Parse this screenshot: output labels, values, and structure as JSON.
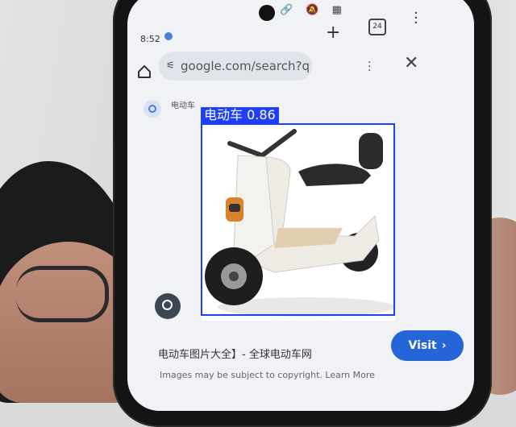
{
  "status_bar": {
    "time": "8:52"
  },
  "browser": {
    "tab_count": "24",
    "url": "google.com/search?q=目"
  },
  "search_chip": {
    "label": "电动车"
  },
  "detection": {
    "label": "电动车 0.86",
    "class": "电动车",
    "confidence": 0.86,
    "box_color": "#1f3fff"
  },
  "result": {
    "title": "电动车图片大全】- 全球电动车网",
    "visit_label": "Visit",
    "fine_print": "Images may be subject to copyright. Learn More"
  },
  "icons": [
    "home-icon",
    "plus-icon",
    "tabs-icon",
    "menu-icon",
    "close-icon",
    "lens-icon",
    "chevron-right-icon"
  ],
  "colors": {
    "accent": "#2565d9",
    "screen_bg": "#f1f2f6"
  }
}
